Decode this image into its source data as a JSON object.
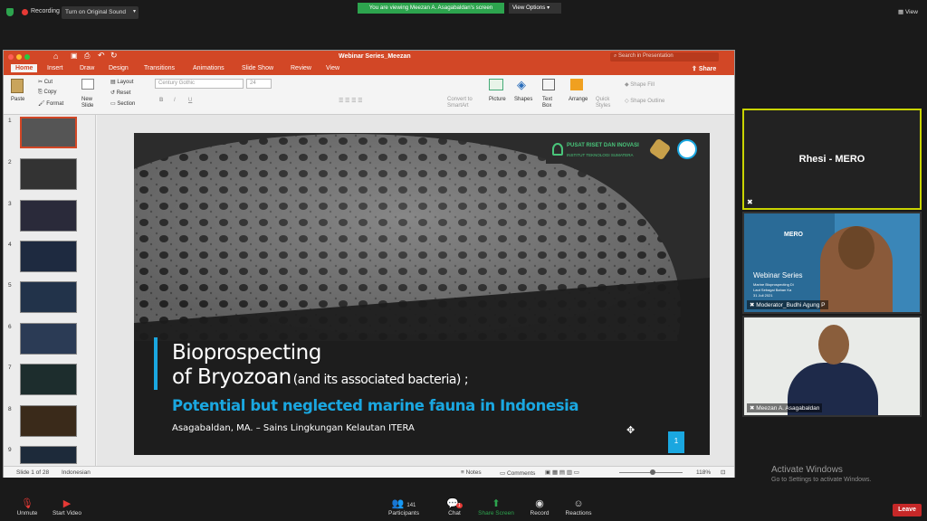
{
  "zoom": {
    "recording": "Recording",
    "audio_button": "Turn on Original Sound",
    "banner": "You are viewing Meezan A. Asagabaldan's screen",
    "view_options": "View Options",
    "view": "View",
    "controls": [
      "Unmute",
      "Start Video",
      "Participants",
      "Chat",
      "Share Screen",
      "Record",
      "Reactions"
    ],
    "participants_count": "141",
    "chat_badge": "1",
    "leave": "Leave",
    "activate_title": "Activate Windows",
    "activate_sub": "Go to Settings to activate Windows."
  },
  "tiles": [
    {
      "name": "Rhesi - MERO"
    },
    {
      "label": "Moderator_Budhi Agung P"
    },
    {
      "label": "Meezan A. Asagabaldan"
    }
  ],
  "tile2_slide": {
    "title": "Webinar Series",
    "brand": "MERO",
    "sub1": "Marine Bioprospecting Di",
    "sub2": "Laut Sebagai Bahan Ka",
    "date": "31 Juli 2021"
  },
  "ppt": {
    "title": "Webinar Series_Meezan",
    "search_placeholder": "Search in Presentation",
    "share": "Share",
    "tabs": [
      "Home",
      "Insert",
      "Draw",
      "Design",
      "Transitions",
      "Animations",
      "Slide Show",
      "Review",
      "View"
    ],
    "paste": "Paste",
    "cut": "Cut",
    "copy": "Copy",
    "format": "Format",
    "new_slide": "New Slide",
    "layout": "Layout",
    "reset": "Reset",
    "section": "Section",
    "font": "Century Gothic",
    "font_size": "24",
    "convert": "Convert to SmartArt",
    "picture": "Picture",
    "shapes": "Shapes",
    "textbox": "Text Box",
    "arrange": "Arrange",
    "quick_styles": "Quick Styles",
    "shape_fill": "Shape Fill",
    "shape_outline": "Shape Outline",
    "status_slide": "Slide 1 of 28",
    "status_lang": "Indonesian",
    "notes": "Notes",
    "comments": "Comments",
    "zoom_level": "118%",
    "thumb_numbers": [
      "1",
      "2",
      "3",
      "4",
      "5",
      "6",
      "7",
      "8",
      "9"
    ]
  },
  "slide": {
    "title1": "Bioprospecting",
    "title2": "of Bryozoan",
    "title2_small": "(and its associated bacteria) ;",
    "subtitle": "Potential but neglected marine fauna in Indonesia",
    "author": "Asagabaldan, MA. – Sains Lingkungan Kelautan ITERA",
    "logo_text1": "PUSAT RISET DAN INOVASI",
    "logo_text2": "INSTITUT TEKNOLOGI SUMATERA",
    "page_num": "1"
  },
  "colors": {
    "accent": "#d24726",
    "blue": "#1aa7e0",
    "zoom_green": "#2da44e",
    "leave": "#c62828"
  }
}
